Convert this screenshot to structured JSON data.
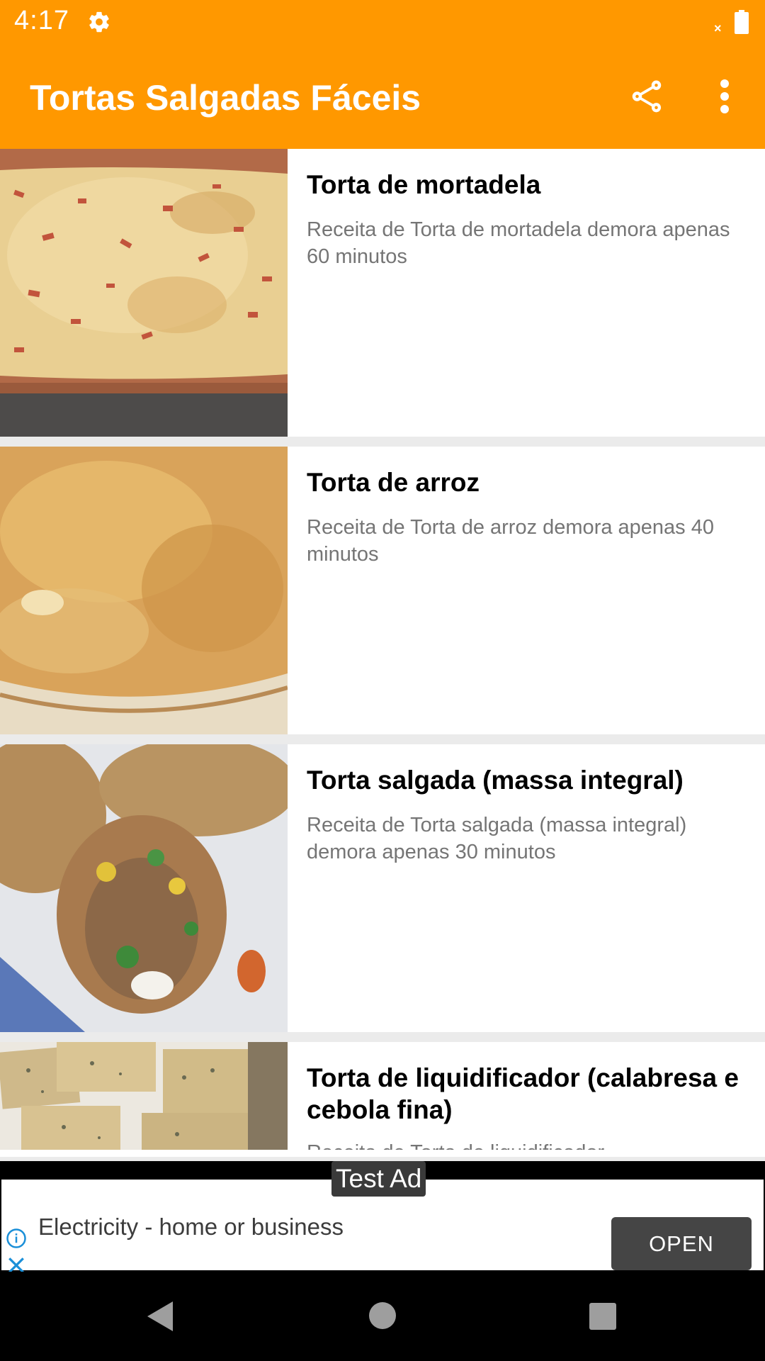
{
  "status_bar": {
    "time": "4:17",
    "settings_icon": "gear-icon",
    "signal_icon": "no-signal-x-icon",
    "battery_icon": "battery-icon"
  },
  "app_bar": {
    "title": "Tortas Salgadas Fáceis",
    "share_icon": "share-icon",
    "menu_icon": "more-vert-icon",
    "background_color": "#ff9800"
  },
  "recipes": [
    {
      "title": "Torta de mortadela",
      "description": "Receita de Torta de mortadela demora apenas 60 minutos",
      "image": "mortadela-pie-photo"
    },
    {
      "title": "Torta de arroz",
      "description": "Receita de Torta de arroz demora apenas 40 minutos",
      "image": "rice-pie-photo"
    },
    {
      "title": "Torta salgada (massa integral)",
      "description": "Receita de Torta salgada (massa integral) demora apenas 30 minutos",
      "image": "wholegrain-pie-photo"
    },
    {
      "title": "Torta de liquidificador (calabresa e cebola fina)",
      "description": "Receita de Torta de liquidificador",
      "image": "blender-pie-photo"
    }
  ],
  "ad": {
    "label": "Test Ad",
    "text": "Electricity - home or business",
    "button": "OPEN",
    "info_icon": "info-icon",
    "close_icon": "close-icon"
  },
  "nav_bar": {
    "back_icon": "back-icon",
    "home_icon": "home-icon",
    "recents_icon": "recents-icon"
  }
}
